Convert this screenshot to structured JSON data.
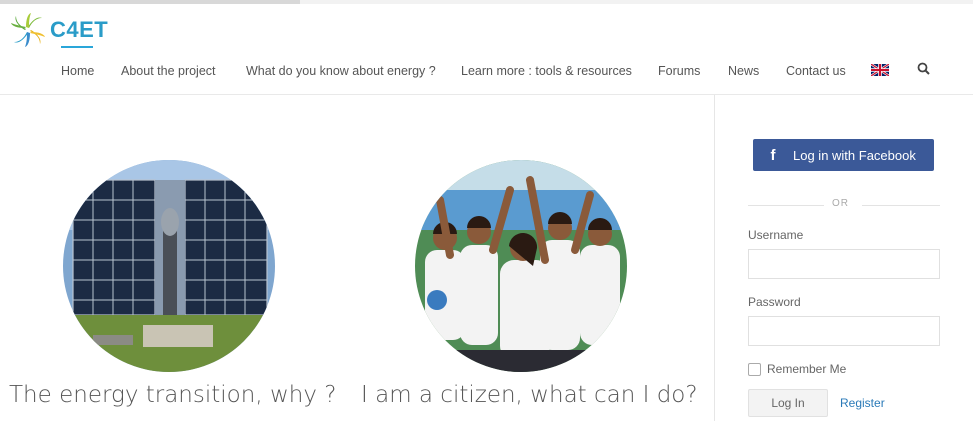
{
  "brand": {
    "name": "C4ET",
    "accent": "#2aa6d9"
  },
  "nav": {
    "items": [
      {
        "label": "Home",
        "active": true
      },
      {
        "label": "About the project"
      },
      {
        "label": "What do you know about energy ?"
      },
      {
        "label": "Learn more : tools & resources"
      },
      {
        "label": "Forums"
      },
      {
        "label": "News"
      },
      {
        "label": "Contact us"
      }
    ],
    "language_flag": "uk-flag-icon",
    "search_icon": "search-icon"
  },
  "features": [
    {
      "caption": "The energy transition, why ?",
      "image": "solar-panel-tower-photo"
    },
    {
      "caption": "I am a citizen, what can I do?",
      "image": "citizens-group-photo"
    }
  ],
  "login": {
    "facebook_label": "Log in with Facebook",
    "facebook_color": "#3b5998",
    "or_text": "OR",
    "username_label": "Username",
    "username_value": "",
    "password_label": "Password",
    "password_value": "",
    "remember_label": "Remember Me",
    "login_button": "Log In",
    "register_link": "Register"
  }
}
